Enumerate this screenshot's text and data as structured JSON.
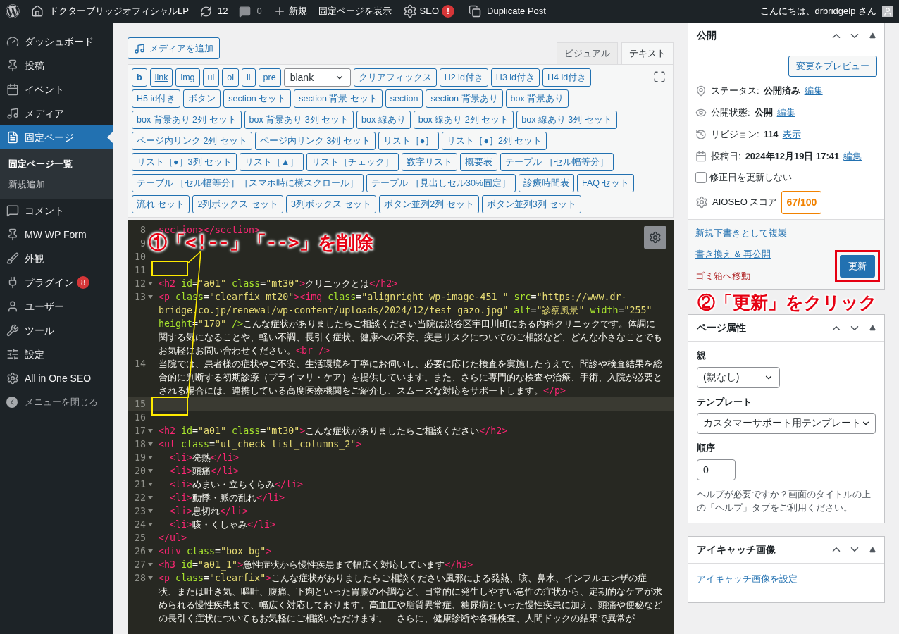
{
  "admin_bar": {
    "site_name": "ドクターブリッジオフィシャルLP",
    "updates": "12",
    "comments": "0",
    "new": "新規",
    "view": "固定ページを表示",
    "seo": "SEO",
    "seo_badge": "!",
    "duplicate": "Duplicate Post",
    "greeting": "こんにちは、drbridgelp さん"
  },
  "sidebar": {
    "items": [
      {
        "label": "ダッシュボード",
        "selected": false
      },
      {
        "label": "投稿",
        "selected": false
      },
      {
        "label": "イベント",
        "selected": false
      },
      {
        "label": "メディア",
        "selected": false
      },
      {
        "label": "固定ページ",
        "selected": true,
        "children": [
          {
            "label": "固定ページ一覧",
            "selected": true
          },
          {
            "label": "新規追加",
            "selected": false
          }
        ]
      },
      {
        "label": "コメント",
        "selected": false
      },
      {
        "label": "MW WP Form",
        "selected": false
      },
      {
        "label": "外観",
        "selected": false
      },
      {
        "label": "プラグイン",
        "selected": false,
        "badge": "8"
      },
      {
        "label": "ユーザー",
        "selected": false
      },
      {
        "label": "ツール",
        "selected": false
      },
      {
        "label": "設定",
        "selected": false
      },
      {
        "label": "All in One SEO",
        "selected": false
      }
    ],
    "collapse_label": "メニューを閉じる"
  },
  "editor": {
    "media_button": "メディアを追加",
    "tabs": [
      {
        "label": "ビジュアル",
        "selected": false
      },
      {
        "label": "テキスト",
        "selected": true
      }
    ],
    "quicktags": [
      {
        "kind": "bold",
        "label": "b"
      },
      {
        "kind": "link",
        "label": "link"
      },
      {
        "kind": "button",
        "label": "img"
      },
      {
        "kind": "button",
        "label": "ul"
      },
      {
        "kind": "button",
        "label": "ol"
      },
      {
        "kind": "button",
        "label": "li"
      },
      {
        "kind": "button",
        "label": "pre"
      },
      {
        "kind": "select",
        "label": "blank"
      },
      {
        "kind": "button",
        "label": "クリアフィックス"
      },
      {
        "kind": "button",
        "label": "H2 id付き"
      },
      {
        "kind": "button",
        "label": "H3 id付き"
      },
      {
        "kind": "button",
        "label": "H4 id付き"
      },
      {
        "kind": "button",
        "label": "H5 id付き"
      },
      {
        "kind": "button",
        "label": "ボタン"
      },
      {
        "kind": "button",
        "label": "section セット"
      },
      {
        "kind": "button",
        "label": "section 背景 セット"
      },
      {
        "kind": "button",
        "label": "section"
      },
      {
        "kind": "button",
        "label": "section 背景あり"
      },
      {
        "kind": "button",
        "label": "box 背景あり"
      },
      {
        "kind": "button",
        "label": "box 背景あり 2列 セット"
      },
      {
        "kind": "button",
        "label": "box 背景あり 3列 セット"
      },
      {
        "kind": "button",
        "label": "box 線あり"
      },
      {
        "kind": "button",
        "label": "box 線あり 2列 セット"
      },
      {
        "kind": "button",
        "label": "box 線あり 3列 セット"
      },
      {
        "kind": "button",
        "label": "ページ内リンク 2列 セット"
      },
      {
        "kind": "button",
        "label": "ページ内リンク 3列 セット"
      },
      {
        "kind": "button",
        "label": "リスト［●］"
      },
      {
        "kind": "button",
        "label": "リスト［●］2列 セット"
      },
      {
        "kind": "button",
        "label": "リスト［●］3列 セット"
      },
      {
        "kind": "button",
        "label": "リスト［▲］"
      },
      {
        "kind": "button",
        "label": "リスト［チェック］"
      },
      {
        "kind": "button",
        "label": "数字リスト"
      },
      {
        "kind": "button",
        "label": "概要表"
      },
      {
        "kind": "button",
        "label": "テーブル ［セル幅等分］"
      },
      {
        "kind": "button",
        "label": "テーブル ［セル幅等分］［スマホ時に横スクロール］"
      },
      {
        "kind": "button",
        "label": "テーブル ［見出しセル30%固定］"
      },
      {
        "kind": "button",
        "label": "診療時間表"
      },
      {
        "kind": "button",
        "label": "FAQ セット"
      },
      {
        "kind": "button",
        "label": "流れ セット"
      },
      {
        "kind": "button",
        "label": "2列ボックス セット"
      },
      {
        "kind": "button",
        "label": "3列ボックス セット"
      },
      {
        "kind": "button",
        "label": "ボタン並列2列 セット"
      },
      {
        "kind": "button",
        "label": "ボタン並列3列 セット"
      }
    ],
    "code_lines": [
      {
        "number": "8",
        "fold": false,
        "active": false,
        "segments": [
          {
            "kind": "tag",
            "text": "section></section>"
          }
        ]
      },
      {
        "number": "9",
        "fold": false,
        "active": false
      },
      {
        "number": "10",
        "fold": false,
        "active": false
      },
      {
        "number": "11",
        "fold": false,
        "active": false
      },
      {
        "number": "12",
        "fold": true,
        "active": false,
        "segments": [
          {
            "kind": "tag",
            "text": "<h2"
          },
          {
            "kind": "attr",
            "text": " id"
          },
          {
            "kind": "op",
            "text": "="
          },
          {
            "kind": "str",
            "text": "\"a01\""
          },
          {
            "kind": "attr",
            "text": " class"
          },
          {
            "kind": "op",
            "text": "="
          },
          {
            "kind": "str",
            "text": "\"mt30\""
          },
          {
            "kind": "tag",
            "text": ">"
          },
          {
            "kind": "text",
            "text": "クリニックとは"
          },
          {
            "kind": "tag",
            "text": "</h2>"
          }
        ]
      },
      {
        "number": "13",
        "fold": true,
        "active": false,
        "segments": [
          {
            "kind": "tag",
            "text": "<p"
          },
          {
            "kind": "attr",
            "text": " class"
          },
          {
            "kind": "op",
            "text": "="
          },
          {
            "kind": "str",
            "text": "\"clearfix mt20\""
          },
          {
            "kind": "tag",
            "text": ">"
          },
          {
            "kind": "tag",
            "text": "<img"
          },
          {
            "kind": "attr",
            "text": " class"
          },
          {
            "kind": "op",
            "text": "="
          },
          {
            "kind": "str",
            "text": "\"alignright wp-image-451 \""
          },
          {
            "kind": "attr",
            "text": " src"
          },
          {
            "kind": "op",
            "text": "="
          },
          {
            "kind": "str",
            "text": "\"https://www.dr-bridge.co.jp/renewal/wp-content/uploads/2024/12/test_gazo.jpg\""
          },
          {
            "kind": "attr",
            "text": " alt"
          },
          {
            "kind": "op",
            "text": "="
          },
          {
            "kind": "str",
            "text": "\"診察風景\""
          },
          {
            "kind": "attr",
            "text": " width"
          },
          {
            "kind": "op",
            "text": "="
          },
          {
            "kind": "str",
            "text": "\"255\""
          },
          {
            "kind": "attr",
            "text": " height"
          },
          {
            "kind": "op",
            "text": "="
          },
          {
            "kind": "str",
            "text": "\"170\""
          },
          {
            "kind": "attr",
            "text": " />"
          },
          {
            "kind": "text",
            "text": "こんな症状がありましたらご相談ください当院は渋谷区宇田川町にある内科クリニックです。体調に関する気になることや、軽い不調、長引く症状、健康への不安、疾患リスクについてのご相談など、どんな小さなことでもお気軽にお問い合わせください。"
          },
          {
            "kind": "tag",
            "text": "<br />"
          }
        ]
      },
      {
        "number": "14",
        "fold": false,
        "active": false,
        "segments": [
          {
            "kind": "text",
            "text": "当院では、患者様の症状やご不安、生活環境を丁寧にお伺いし、必要に応じた検査を実施したうえで、問診や検査結果を総合的に判断する初期診療（プライマリ・ケア）を提供しています。また、さらに専門的な検査や治療、手術、入院が必要とされる場合には、連携している高度医療機関をご紹介し、スムーズな対応をサポートします。"
          },
          {
            "kind": "tag",
            "text": "</p>"
          }
        ]
      },
      {
        "number": "15",
        "fold": false,
        "active": true
      },
      {
        "number": "16",
        "fold": false,
        "active": false
      },
      {
        "number": "17",
        "fold": true,
        "active": false,
        "segments": [
          {
            "kind": "tag",
            "text": "<h2"
          },
          {
            "kind": "attr",
            "text": " id"
          },
          {
            "kind": "op",
            "text": "="
          },
          {
            "kind": "str",
            "text": "\"a01\""
          },
          {
            "kind": "attr",
            "text": " class"
          },
          {
            "kind": "op",
            "text": "="
          },
          {
            "kind": "str",
            "text": "\"mt30\""
          },
          {
            "kind": "tag",
            "text": ">"
          },
          {
            "kind": "text",
            "text": "こんな症状がありましたらご相談ください"
          },
          {
            "kind": "tag",
            "text": "</h2>"
          }
        ]
      },
      {
        "number": "18",
        "fold": true,
        "active": false,
        "segments": [
          {
            "kind": "tag",
            "text": "<ul"
          },
          {
            "kind": "attr",
            "text": " class"
          },
          {
            "kind": "op",
            "text": "="
          },
          {
            "kind": "str",
            "text": "\"ul_check list_columns_2\""
          },
          {
            "kind": "tag",
            "text": ">"
          }
        ]
      },
      {
        "number": "19",
        "fold": true,
        "active": false,
        "segments": [
          {
            "kind": "tag",
            "text": "  <li>"
          },
          {
            "kind": "text",
            "text": "発熱"
          },
          {
            "kind": "tag",
            "text": "</li>"
          }
        ]
      },
      {
        "number": "20",
        "fold": true,
        "active": false,
        "segments": [
          {
            "kind": "tag",
            "text": "  <li>"
          },
          {
            "kind": "text",
            "text": "頭痛"
          },
          {
            "kind": "tag",
            "text": "</li>"
          }
        ]
      },
      {
        "number": "21",
        "fold": true,
        "active": false,
        "segments": [
          {
            "kind": "tag",
            "text": "  <li>"
          },
          {
            "kind": "text",
            "text": "めまい・立ちくらみ"
          },
          {
            "kind": "tag",
            "text": "</li>"
          }
        ]
      },
      {
        "number": "22",
        "fold": true,
        "active": false,
        "segments": [
          {
            "kind": "tag",
            "text": "  <li>"
          },
          {
            "kind": "text",
            "text": "動悸・脈の乱れ"
          },
          {
            "kind": "tag",
            "text": "</li>"
          }
        ]
      },
      {
        "number": "23",
        "fold": true,
        "active": false,
        "segments": [
          {
            "kind": "tag",
            "text": "  <li>"
          },
          {
            "kind": "text",
            "text": "息切れ"
          },
          {
            "kind": "tag",
            "text": "</li>"
          }
        ]
      },
      {
        "number": "24",
        "fold": true,
        "active": false,
        "segments": [
          {
            "kind": "tag",
            "text": "  <li>"
          },
          {
            "kind": "text",
            "text": "咳・くしゃみ"
          },
          {
            "kind": "tag",
            "text": "</li>"
          }
        ]
      },
      {
        "number": "25",
        "fold": false,
        "active": false,
        "segments": [
          {
            "kind": "tag",
            "text": "</ul>"
          }
        ]
      },
      {
        "number": "26",
        "fold": true,
        "active": false,
        "segments": [
          {
            "kind": "tag",
            "text": "<div"
          },
          {
            "kind": "attr",
            "text": " class"
          },
          {
            "kind": "op",
            "text": "="
          },
          {
            "kind": "str",
            "text": "\"box_bg\""
          },
          {
            "kind": "tag",
            "text": ">"
          }
        ]
      },
      {
        "number": "27",
        "fold": true,
        "active": false,
        "segments": [
          {
            "kind": "tag",
            "text": "<h3"
          },
          {
            "kind": "attr",
            "text": " id"
          },
          {
            "kind": "op",
            "text": "="
          },
          {
            "kind": "str",
            "text": "\"a01_1\""
          },
          {
            "kind": "tag",
            "text": ">"
          },
          {
            "kind": "text",
            "text": "急性症状から慢性疾患まで幅広く対応しています"
          },
          {
            "kind": "tag",
            "text": "</h3>"
          }
        ]
      },
      {
        "number": "28",
        "fold": true,
        "active": false,
        "segments": [
          {
            "kind": "tag",
            "text": "<p"
          },
          {
            "kind": "attr",
            "text": " class"
          },
          {
            "kind": "op",
            "text": "="
          },
          {
            "kind": "str",
            "text": "\"clearfix\""
          },
          {
            "kind": "tag",
            "text": ">"
          },
          {
            "kind": "text",
            "text": "こんな症状がありましたらご相談ください風邪による発熱、咳、鼻水、インフルエンザの症状、または吐き気、嘔吐、腹痛、下痢といった胃腸の不調など、日常的に発生しやすい急性の症状から、定期的なケアが求められる慢性疾患まで、幅広く対応しております。高血圧や脂質異常症、糖尿病といった慢性疾患に加え、頭痛や便秘などの長引く症状についてもお気軽にご相談いただけます。　さらに、健康診断や各種検査、人間ドックの結果で異常が"
          }
        ]
      }
    ]
  },
  "annotations": {
    "step1": "①「<!--」「-->」を削除",
    "step2": "②「更新」をクリック"
  },
  "publish": {
    "title": "公開",
    "preview_button": "変更をプレビュー",
    "meta": [
      {
        "kind": "status",
        "label": "ステータス:",
        "value": "公開済み",
        "link": "編集"
      },
      {
        "kind": "visibility",
        "label": "公開状態:",
        "value": "公開",
        "link": "編集"
      },
      {
        "kind": "revisions",
        "label": "リビジョン:",
        "value": "114",
        "link": "表示"
      },
      {
        "kind": "date",
        "label": "投稿日:",
        "value": "2024年12月19日 17:41",
        "link": "編集"
      }
    ],
    "checkbox": {
      "label": "修正日を更新しない",
      "checked": false
    },
    "aioseo": {
      "label": "AIOSEO スコア",
      "score": "67/100"
    },
    "links": [
      "新規下書きとして複製",
      "書き換え & 再公開"
    ],
    "trash": "ゴミ箱へ移動",
    "update_button": "更新"
  },
  "page_attributes": {
    "title": "ページ属性",
    "parent_label": "親",
    "parent_value": "(親なし)",
    "template_label": "テンプレート",
    "template_value": "カスタマーサポート用テンプレート",
    "order_label": "順序",
    "order_value": "0",
    "help": "ヘルプが必要ですか？画面のタイトルの上の「ヘルプ」タブをご利用ください。"
  },
  "featured_image": {
    "title": "アイキャッチ画像",
    "link": "アイキャッチ画像を設定"
  }
}
